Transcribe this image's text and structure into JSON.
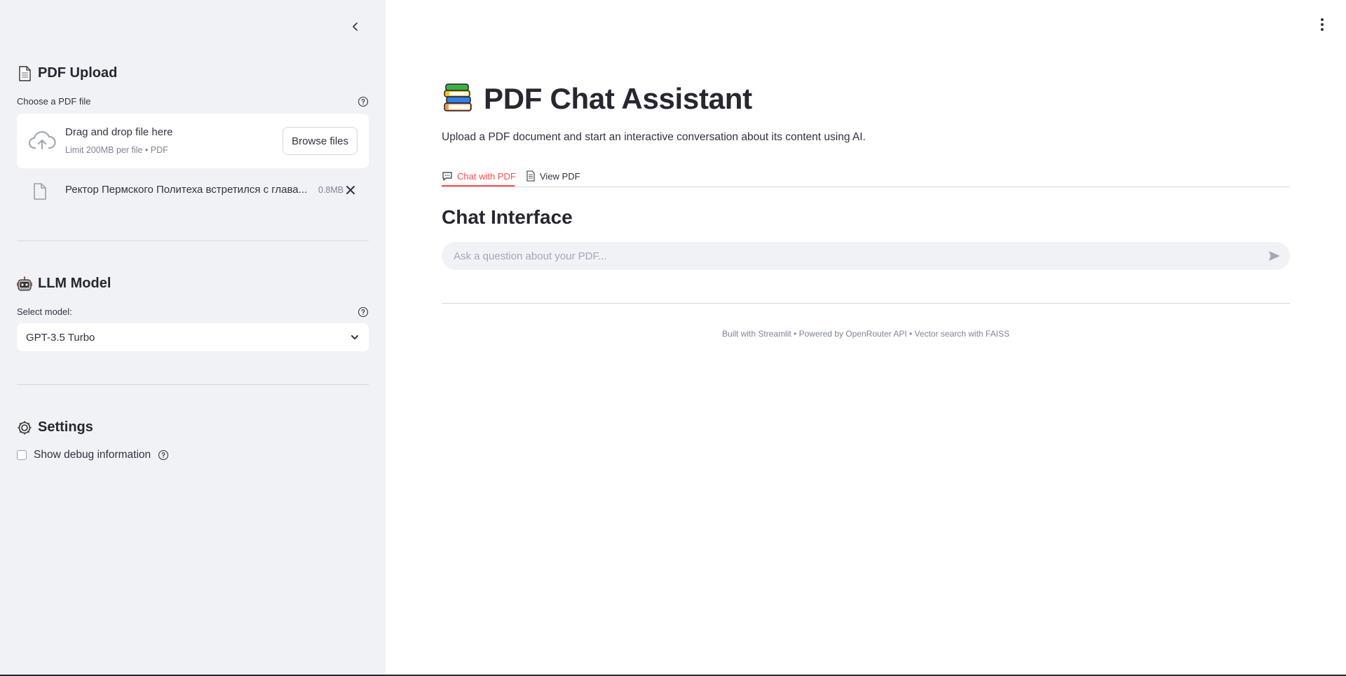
{
  "sidebar": {
    "pdf_upload": {
      "heading": "PDF Upload",
      "field_label": "Choose a PDF file",
      "uploader": {
        "drag_text": "Drag and drop file here",
        "limit_text": "Limit 200MB per file • PDF",
        "browse_label": "Browse files"
      },
      "uploaded_file": {
        "name": "Ректор Пермского Политеха встретился с глава...",
        "size": "0.8MB"
      }
    },
    "llm_model": {
      "heading": "LLM Model",
      "field_label": "Select model:",
      "selected": "GPT-3.5 Turbo"
    },
    "settings": {
      "heading": "Settings",
      "debug_label": "Show debug information"
    }
  },
  "main": {
    "title": "PDF Chat Assistant",
    "subtitle": "Upload a PDF document and start an interactive conversation about its content using AI.",
    "tabs": [
      {
        "label": "Chat with PDF",
        "icon": "chat-icon",
        "active": true
      },
      {
        "label": "View PDF",
        "icon": "document-icon",
        "active": false
      }
    ],
    "section_title": "Chat Interface",
    "chat_placeholder": "Ask a question about your PDF...",
    "footer": "Built with Streamlit • Powered by OpenRouter API • Vector search with FAISS"
  },
  "colors": {
    "accent": "#ff4b4b",
    "sidebar_bg": "#f0f2f6",
    "text": "#31333f"
  }
}
